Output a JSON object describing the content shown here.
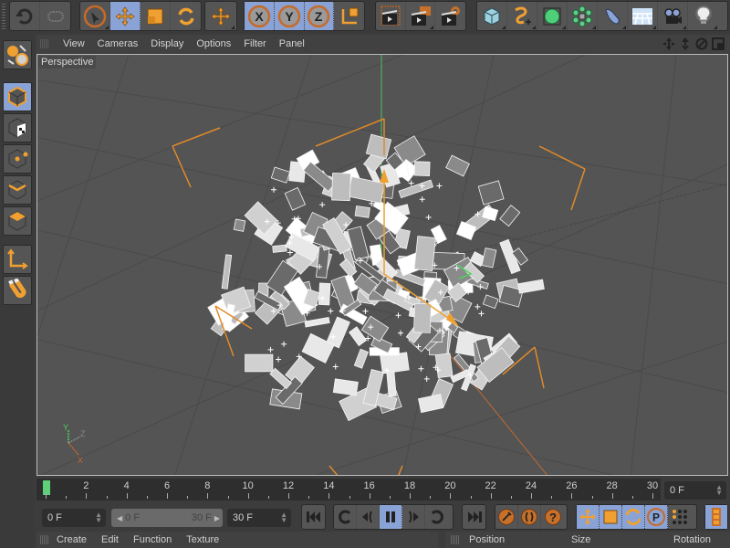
{
  "toolbar": {
    "history": [
      {
        "icon": "undo-icon"
      },
      {
        "icon": "redo-icon"
      }
    ],
    "tools": [
      {
        "icon": "live-selection-icon",
        "active": false
      },
      {
        "icon": "move-icon",
        "active": true
      },
      {
        "icon": "scale-icon",
        "active": false
      },
      {
        "icon": "rotate-icon",
        "active": false
      }
    ],
    "recent_tool": {
      "icon": "move-tool-icon"
    },
    "axes": [
      {
        "icon": "x-axis-lock-icon",
        "label": "X",
        "active": true
      },
      {
        "icon": "y-axis-lock-icon",
        "label": "Y",
        "active": true
      },
      {
        "icon": "z-axis-lock-icon",
        "label": "Z",
        "active": true
      }
    ],
    "coord_system": {
      "icon": "world-coordinate-icon"
    },
    "render": [
      {
        "icon": "render-view-icon"
      },
      {
        "icon": "render-to-picture-viewer-icon"
      },
      {
        "icon": "render-settings-icon"
      }
    ],
    "objects": [
      {
        "icon": "cube-primitive-icon"
      },
      {
        "icon": "spline-pen-icon"
      },
      {
        "icon": "subdivision-surface-icon"
      },
      {
        "icon": "cloner-icon"
      },
      {
        "icon": "deformer-bend-icon"
      },
      {
        "icon": "floor-environment-icon"
      },
      {
        "icon": "camera-icon"
      },
      {
        "icon": "light-icon"
      }
    ]
  },
  "leftbar": {
    "items": [
      {
        "icon": "make-editable-icon"
      },
      {
        "icon": "model-mode-icon",
        "active": true
      },
      {
        "icon": "texture-mode-icon"
      },
      {
        "icon": "points-mode-icon"
      },
      {
        "icon": "edges-mode-icon"
      },
      {
        "icon": "polygons-mode-icon"
      },
      {
        "icon": "axis-mode-icon"
      },
      {
        "icon": "snap-magnet-icon"
      }
    ]
  },
  "viewport": {
    "menu": [
      "View",
      "Cameras",
      "Display",
      "Options",
      "Filter",
      "Panel"
    ],
    "nav_icons": [
      "pan-icon",
      "zoom-view-icon",
      "orbit-icon",
      "layout-toggle-icon"
    ],
    "label": "Perspective",
    "axis_labels": {
      "y": "Y",
      "x": "X",
      "z": "Z"
    }
  },
  "timeline": {
    "ticks": [
      "2",
      "4",
      "6",
      "8",
      "10",
      "12",
      "14",
      "16",
      "18",
      "20",
      "22",
      "24",
      "26",
      "28",
      "30"
    ],
    "current_frame_field": "0 F"
  },
  "range": {
    "start": "0 F",
    "slider_start": "0 F",
    "slider_end": "30 F",
    "end": "30 F"
  },
  "transport": {
    "goto_start": "goto-start-icon",
    "controls": [
      {
        "icon": "goto-prev-key-icon"
      },
      {
        "icon": "step-back-icon"
      },
      {
        "icon": "pause-icon",
        "active": true
      },
      {
        "icon": "step-forward-icon"
      },
      {
        "icon": "goto-next-key-icon"
      }
    ],
    "goto_end": "goto-end-icon",
    "record": [
      {
        "icon": "record-active-objects-icon"
      },
      {
        "icon": "autokeying-icon"
      },
      {
        "icon": "keyframe-selection-icon"
      }
    ],
    "key_tracks": [
      {
        "icon": "record-position-icon",
        "active": true
      },
      {
        "icon": "record-scale-icon",
        "active": true
      },
      {
        "icon": "record-rotation-icon",
        "active": true
      },
      {
        "icon": "record-parameter-icon",
        "active": true
      },
      {
        "icon": "record-point-level-icon",
        "active": false
      }
    ],
    "scheme": {
      "icon": "interpolation-scheme-icon",
      "active": true
    }
  },
  "material_panel": {
    "menu": [
      "Create",
      "Edit",
      "Function",
      "Texture"
    ]
  },
  "attributes_panel": {
    "columns": [
      "Position",
      "Size",
      "Rotation"
    ]
  },
  "colors": {
    "accent_orange": "#e08a2a",
    "active_blue": "#8aa3d6",
    "playhead_green": "#5fd07a"
  }
}
